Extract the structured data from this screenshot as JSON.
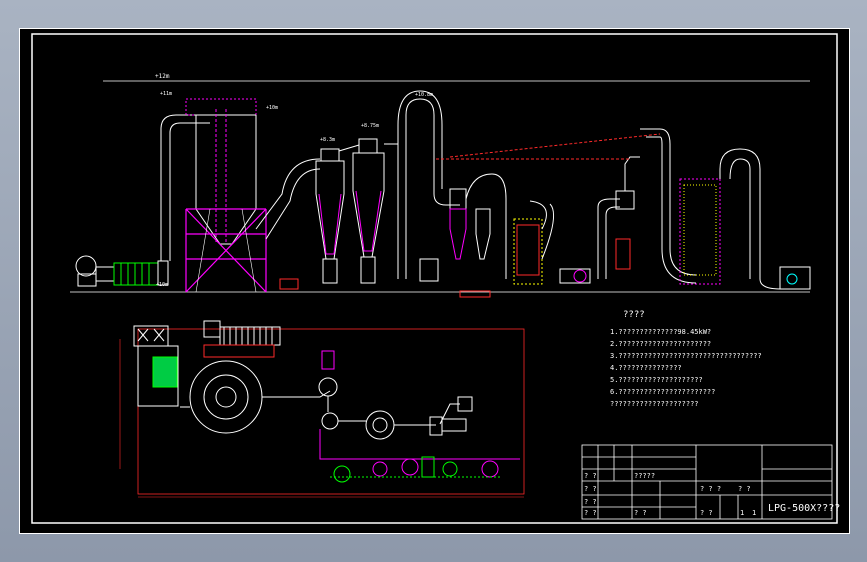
{
  "elevations": {
    "top": "+12m",
    "tower_top": "+11m",
    "roof": "+10m",
    "cyclone_1": "+8.3m",
    "cyclone_2": "+8.75m",
    "duct_peak": "+10.8m",
    "ground_left": "+10m",
    "ground_right": "+10m"
  },
  "notes": {
    "title": "????",
    "items": [
      "1.??????????????98.45kW?",
      "2.??????????????????????",
      "3.??????????????????????????????????",
      "4.???????????????",
      "5.????????????????????",
      "6.???????????????????????",
      "  ?????????????????????"
    ]
  },
  "title_block": {
    "drawing_title": "LPG-500X????",
    "cells": [
      "? ?",
      "?????",
      "? ? ?",
      "? ?",
      "? ? ?",
      "? ?",
      "? ?",
      "? ?",
      "? ?",
      "? ?",
      "? ?",
      "1",
      "1"
    ]
  },
  "colors": {
    "background": "#000000",
    "frame": "#ffffff",
    "equipment": "#ffffff",
    "dimension": "#ff2a2a",
    "structure": "#ff00ff",
    "highlight": "#00ff00",
    "fan": "#00ffff",
    "burner": "#ffff00"
  }
}
